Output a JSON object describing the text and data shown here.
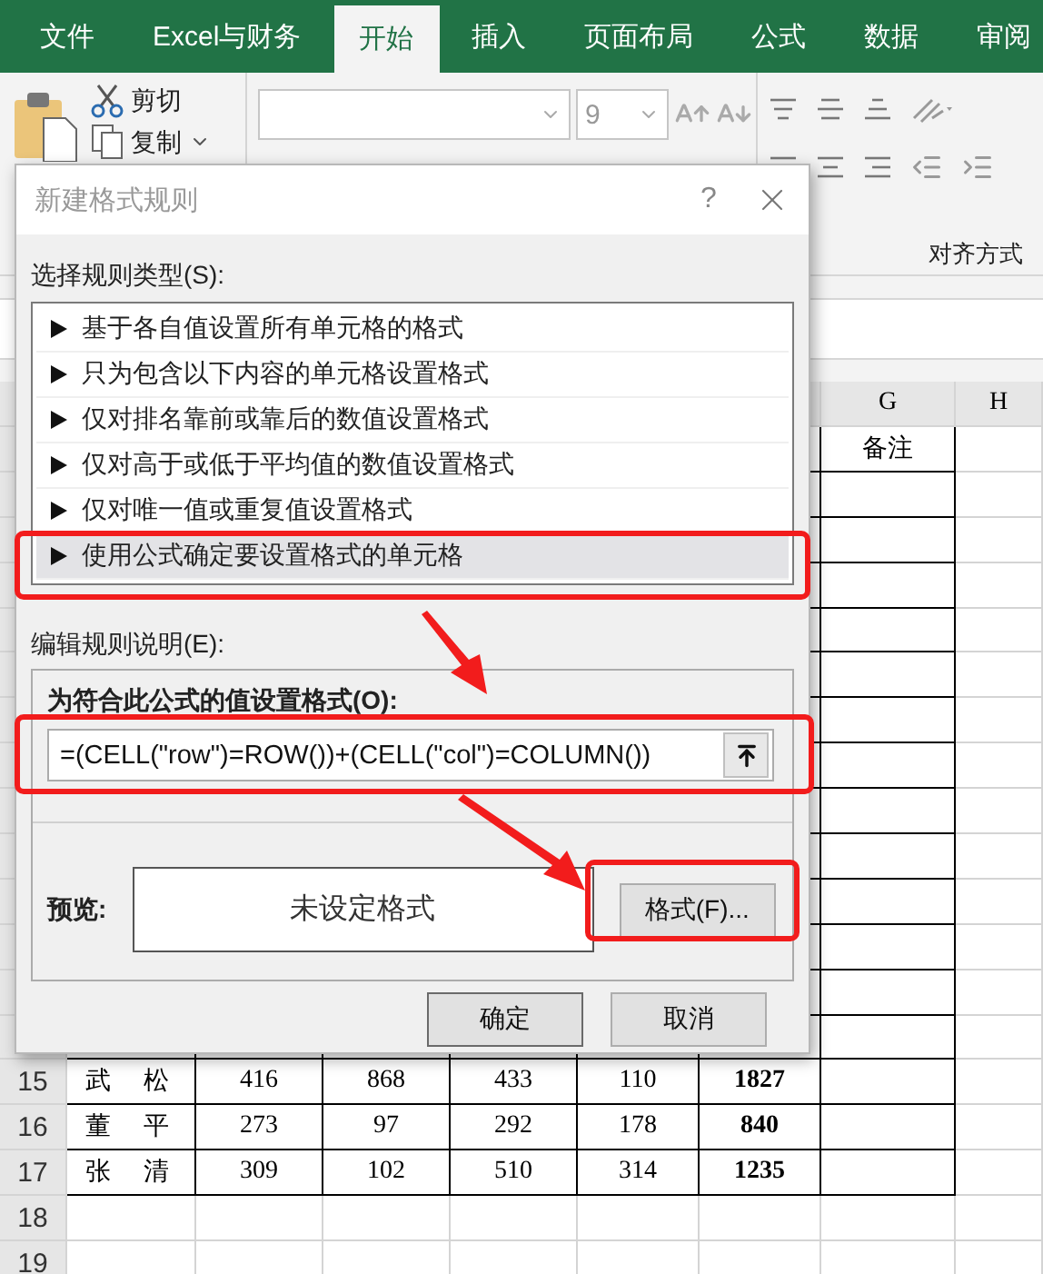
{
  "ribbon_tabs": [
    {
      "label": "文件",
      "selected": false
    },
    {
      "label": "Excel与财务",
      "selected": false
    },
    {
      "label": "开始",
      "selected": true
    },
    {
      "label": "插入",
      "selected": false
    },
    {
      "label": "页面布局",
      "selected": false
    },
    {
      "label": "公式",
      "selected": false
    },
    {
      "label": "数据",
      "selected": false
    },
    {
      "label": "审阅",
      "selected": false
    }
  ],
  "ribbon": {
    "cut": "剪切",
    "copy": "复制",
    "font_size": "9",
    "alignment_group_label": "对齐方式"
  },
  "sheet": {
    "columns": [
      "G",
      "H"
    ],
    "remark_header": "备注",
    "rows": [
      {
        "number": "15",
        "name": "武　松",
        "values": [
          "416",
          "868",
          "433",
          "110"
        ],
        "total": "1827"
      },
      {
        "number": "16",
        "name": "董　平",
        "values": [
          "273",
          "97",
          "292",
          "178"
        ],
        "total": "840"
      },
      {
        "number": "17",
        "name": "张　清",
        "values": [
          "309",
          "102",
          "510",
          "314"
        ],
        "total": "1235"
      },
      {
        "number": "18"
      },
      {
        "number": "19"
      }
    ]
  },
  "dialog": {
    "title": "新建格式规则",
    "help": "?",
    "rule_type_label": "选择规则类型(S):",
    "rule_types": [
      {
        "label": "基于各自值设置所有单元格的格式",
        "selected": false
      },
      {
        "label": "只为包含以下内容的单元格设置格式",
        "selected": false
      },
      {
        "label": "仅对排名靠前或靠后的数值设置格式",
        "selected": false
      },
      {
        "label": "仅对高于或低于平均值的数值设置格式",
        "selected": false
      },
      {
        "label": "仅对唯一值或重复值设置格式",
        "selected": false
      },
      {
        "label": "使用公式确定要设置格式的单元格",
        "selected": true
      }
    ],
    "description_label": "编辑规则说明(E):",
    "formula_label": "为符合此公式的值设置格式(O):",
    "formula": "=(CELL(\"row\")=ROW())+(CELL(\"col\")=COLUMN())",
    "preview_label": "预览:",
    "preview_text": "未设定格式",
    "format_button": "格式(F)...",
    "buttons": [
      {
        "label": "确定",
        "kind": "ok"
      },
      {
        "label": "取消",
        "kind": "cancel"
      }
    ]
  }
}
